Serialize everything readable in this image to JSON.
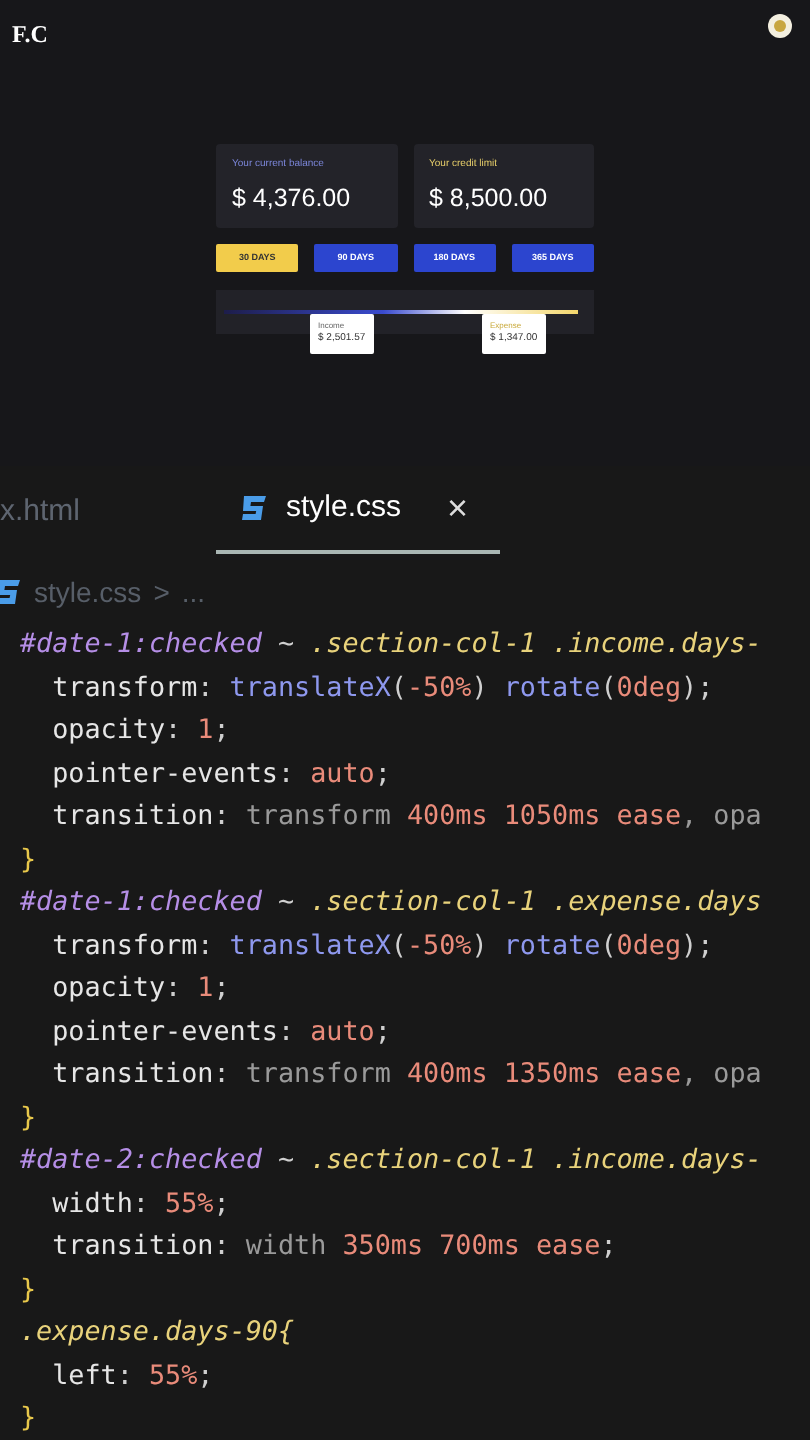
{
  "preview": {
    "logo": "F.C",
    "cards": [
      {
        "label": "Your current balance",
        "amount": "$ 4,376.00",
        "kind": "balance"
      },
      {
        "label": "Your credit limit",
        "amount": "$ 8,500.00",
        "kind": "credit"
      }
    ],
    "periods": [
      {
        "label": "30 DAYS",
        "selected": true
      },
      {
        "label": "90 DAYS",
        "selected": false
      },
      {
        "label": "180 DAYS",
        "selected": false
      },
      {
        "label": "365 DAYS",
        "selected": false
      }
    ],
    "tooltips": [
      {
        "label": "Income",
        "amount": "$ 2,501.57",
        "kind": "income"
      },
      {
        "label": "Expense",
        "amount": "$ 1,347.00",
        "kind": "expense"
      }
    ]
  },
  "editor": {
    "tabs": [
      {
        "label": "x.html",
        "selected": false,
        "kind": "html"
      },
      {
        "label": "style.css",
        "selected": true,
        "kind": "css"
      }
    ],
    "close": "×",
    "breadcrumb": {
      "file": "style.css",
      "separator": ">",
      "rest": "..."
    },
    "rules": [
      {
        "selector": [
          {
            "text": "#date-1:checked",
            "kind": "id"
          },
          {
            "text": " ~ ",
            "kind": "punct"
          },
          {
            "text": ".section-col-1 .income.days-",
            "kind": "class"
          }
        ],
        "declarations": [
          [
            {
              "text": "transform",
              "kind": "prop"
            },
            {
              "text": ": ",
              "kind": "punct"
            },
            {
              "text": "translateX",
              "kind": "fn"
            },
            {
              "text": "(",
              "kind": "punct"
            },
            {
              "text": "-50%",
              "kind": "num"
            },
            {
              "text": ") ",
              "kind": "punct"
            },
            {
              "text": "rotate",
              "kind": "fn"
            },
            {
              "text": "(",
              "kind": "punct"
            },
            {
              "text": "0deg",
              "kind": "num"
            },
            {
              "text": ");",
              "kind": "punct"
            }
          ],
          [
            {
              "text": "opacity",
              "kind": "prop"
            },
            {
              "text": ": ",
              "kind": "punct"
            },
            {
              "text": "1",
              "kind": "num"
            },
            {
              "text": ";",
              "kind": "punct"
            }
          ],
          [
            {
              "text": "pointer-events",
              "kind": "prop"
            },
            {
              "text": ": ",
              "kind": "punct"
            },
            {
              "text": "auto",
              "kind": "num"
            },
            {
              "text": ";",
              "kind": "punct"
            }
          ],
          [
            {
              "text": "transition",
              "kind": "prop"
            },
            {
              "text": ": ",
              "kind": "punct"
            },
            {
              "text": "transform",
              "kind": "value"
            },
            {
              "text": " 400ms 1050ms ease",
              "kind": "num"
            },
            {
              "text": ", opa",
              "kind": "value"
            }
          ]
        ],
        "close": "}"
      },
      {
        "selector": [
          {
            "text": "#date-1:checked",
            "kind": "id"
          },
          {
            "text": " ~ ",
            "kind": "punct"
          },
          {
            "text": ".section-col-1 .expense.days",
            "kind": "class"
          }
        ],
        "declarations": [
          [
            {
              "text": "transform",
              "kind": "prop"
            },
            {
              "text": ": ",
              "kind": "punct"
            },
            {
              "text": "translateX",
              "kind": "fn"
            },
            {
              "text": "(",
              "kind": "punct"
            },
            {
              "text": "-50%",
              "kind": "num"
            },
            {
              "text": ") ",
              "kind": "punct"
            },
            {
              "text": "rotate",
              "kind": "fn"
            },
            {
              "text": "(",
              "kind": "punct"
            },
            {
              "text": "0deg",
              "kind": "num"
            },
            {
              "text": ");",
              "kind": "punct"
            }
          ],
          [
            {
              "text": "opacity",
              "kind": "prop"
            },
            {
              "text": ": ",
              "kind": "punct"
            },
            {
              "text": "1",
              "kind": "num"
            },
            {
              "text": ";",
              "kind": "punct"
            }
          ],
          [
            {
              "text": "pointer-events",
              "kind": "prop"
            },
            {
              "text": ": ",
              "kind": "punct"
            },
            {
              "text": "auto",
              "kind": "num"
            },
            {
              "text": ";",
              "kind": "punct"
            }
          ],
          [
            {
              "text": "transition",
              "kind": "prop"
            },
            {
              "text": ": ",
              "kind": "punct"
            },
            {
              "text": "transform",
              "kind": "value"
            },
            {
              "text": " 400ms 1350ms ease",
              "kind": "num"
            },
            {
              "text": ", opa",
              "kind": "value"
            }
          ]
        ],
        "close": "}"
      },
      {
        "selector": [
          {
            "text": "#date-2:checked",
            "kind": "id"
          },
          {
            "text": " ~ ",
            "kind": "punct"
          },
          {
            "text": ".section-col-1 .income.days-",
            "kind": "class"
          }
        ],
        "declarations": [
          [
            {
              "text": "width",
              "kind": "prop"
            },
            {
              "text": ": ",
              "kind": "punct"
            },
            {
              "text": "55%",
              "kind": "num"
            },
            {
              "text": ";",
              "kind": "punct"
            }
          ],
          [
            {
              "text": "transition",
              "kind": "prop"
            },
            {
              "text": ": ",
              "kind": "punct"
            },
            {
              "text": "width",
              "kind": "value"
            },
            {
              "text": " 350ms 700ms ease",
              "kind": "num"
            },
            {
              "text": ";",
              "kind": "punct"
            }
          ]
        ],
        "close": "}"
      },
      {
        "selector": [
          {
            "text": ".expense.days-90{",
            "kind": "class"
          }
        ],
        "declarations": [
          [
            {
              "text": "left",
              "kind": "prop"
            },
            {
              "text": ": ",
              "kind": "punct"
            },
            {
              "text": "55%",
              "kind": "num"
            },
            {
              "text": ";",
              "kind": "punct"
            }
          ]
        ],
        "close": "}"
      }
    ]
  }
}
